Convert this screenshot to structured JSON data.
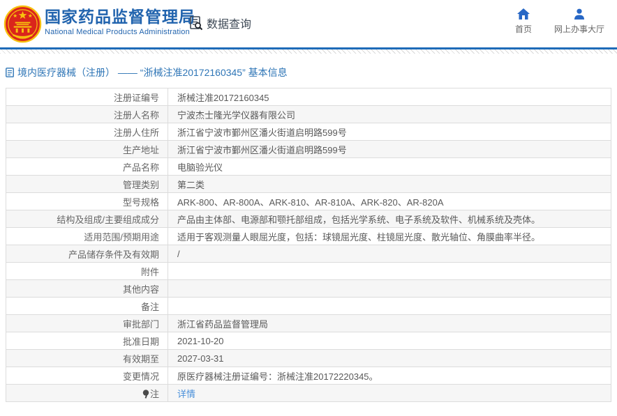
{
  "header": {
    "title": "国家药品监督管理局",
    "subtitle": "National Medical Products Administration",
    "nav_query_label": "数据查询",
    "nav_home_label": "首页",
    "nav_hall_label": "网上办事大厅"
  },
  "breadcrumb": {
    "title": "境内医疗器械（注册） ——  “浙械注准20172160345”  基本信息"
  },
  "table": {
    "rows": [
      {
        "label": "注册证编号",
        "value": "浙械注准20172160345"
      },
      {
        "label": "注册人名称",
        "value": "宁波杰士隆光学仪器有限公司"
      },
      {
        "label": "注册人住所",
        "value": "浙江省宁波市鄞州区潘火街道启明路599号"
      },
      {
        "label": "生产地址",
        "value": "浙江省宁波市鄞州区潘火街道启明路599号"
      },
      {
        "label": "产品名称",
        "value": "电脑验光仪"
      },
      {
        "label": "管理类别",
        "value": "第二类"
      },
      {
        "label": "型号规格",
        "value": "ARK-800、AR-800A、ARK-810、AR-810A、ARK-820、AR-820A"
      },
      {
        "label": "结构及组成/主要组成成分",
        "value": "产品由主体部、电源部和颚托部组成，包括光学系统、电子系统及软件、机械系统及壳体。"
      },
      {
        "label": "适用范围/预期用途",
        "value": "适用于客观测量人眼屈光度，包括：球镜屈光度、柱镜屈光度、散光轴位、角膜曲率半径。"
      },
      {
        "label": "产品储存条件及有效期",
        "value": "/"
      },
      {
        "label": "附件",
        "value": ""
      },
      {
        "label": "其他内容",
        "value": ""
      },
      {
        "label": "备注",
        "value": ""
      },
      {
        "label": "审批部门",
        "value": "浙江省药品监督管理局"
      },
      {
        "label": "批准日期",
        "value": "2021-10-20"
      },
      {
        "label": "有效期至",
        "value": "2027-03-31"
      },
      {
        "label": "变更情况",
        "value": "原医疗器械注册证编号：浙械注准20172220345。"
      },
      {
        "label": "注",
        "value": "详情",
        "is_link": true,
        "has_icon": true
      }
    ]
  },
  "colors": {
    "brand_blue": "#2264ae",
    "divider_blue": "#1e6bb8",
    "breadcrumb_blue": "#2e75b6",
    "link_blue": "#4a90da",
    "emblem_red": "#da251c",
    "emblem_gold": "#f7c10e",
    "alt_row_bg": "#f6f6f6",
    "border_gray": "#dcdcdc"
  }
}
